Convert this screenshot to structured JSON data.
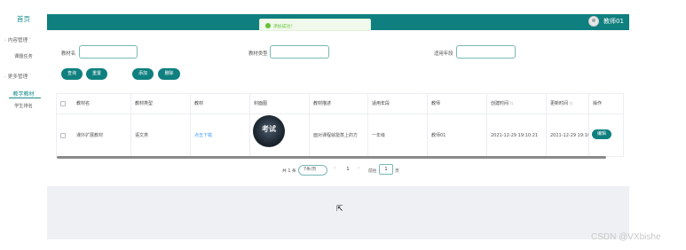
{
  "sidebar": {
    "home": "首页",
    "groups": [
      {
        "label": "内容管理",
        "items": [
          "课题任务"
        ]
      },
      {
        "label": "更多管理",
        "items": [
          "教学教材",
          "学生排名"
        ]
      }
    ]
  },
  "header": {
    "user_name": "教师01"
  },
  "toast": {
    "message": "添加成功！"
  },
  "search": {
    "fields": [
      {
        "label": "教材名",
        "value": ""
      },
      {
        "label": "教材类型",
        "value": ""
      },
      {
        "label": "适用年段",
        "value": ""
      }
    ],
    "buttons": {
      "query": "查询",
      "reset": "重置",
      "add": "添加",
      "delete": "删除"
    }
  },
  "table": {
    "columns": [
      "教材名",
      "教材类型",
      "教材",
      "封面图",
      "教材描述",
      "适用年段",
      "教师",
      "创建时间",
      "更新时间",
      "操作"
    ],
    "rows": [
      {
        "name": "课外扩展教材",
        "type": "语文类",
        "file_link": "点击下载",
        "cover_text": "考试",
        "cover_sub": "· · ·",
        "description": "面对课程就能蒸上的方",
        "grade": "一年级",
        "teacher": "教师01",
        "created": "2021-12-29 19:10:21",
        "updated": "2021-12-29 19:10:21",
        "action": "编辑"
      }
    ]
  },
  "pagination": {
    "total": "共 1 条",
    "page_size": "7条/页",
    "prev": "‹",
    "current": "1",
    "next": "›",
    "goto_prefix": "前往",
    "goto_value": "1",
    "goto_suffix": "页"
  },
  "watermark": "CSDN @VXbishe",
  "icons": {
    "caret": "caret-icon",
    "toast": "success-icon",
    "avatar": "avatar-icon",
    "cursor": "mouse-cursor-icon"
  },
  "colors": {
    "brand": "#0f7f7f",
    "toast_bg": "#f0f9eb",
    "toast_text": "#67c23a",
    "link": "#409eff"
  }
}
